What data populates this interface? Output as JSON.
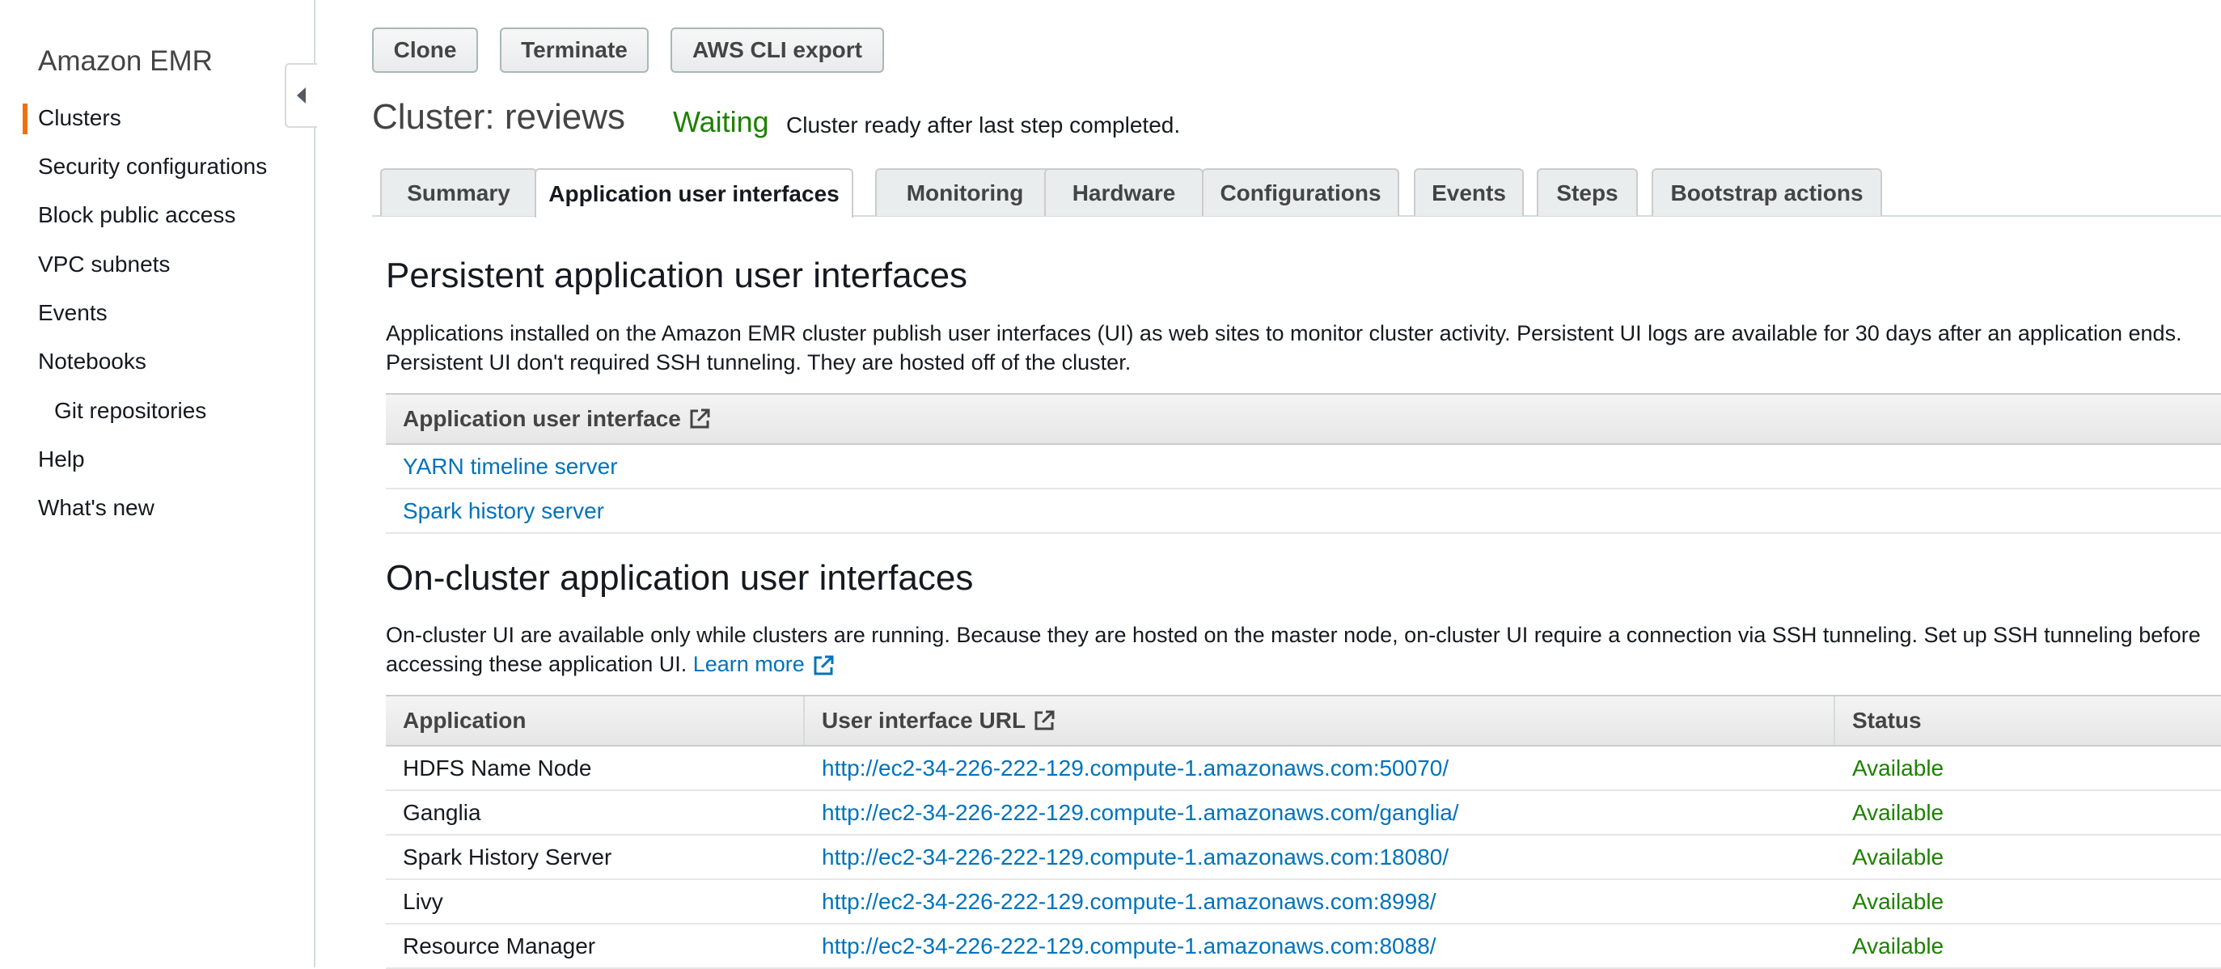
{
  "sidebar": {
    "title": "Amazon EMR",
    "items": [
      {
        "label": "Clusters",
        "active": true
      },
      {
        "label": "Security configurations"
      },
      {
        "label": "Block public access"
      },
      {
        "label": "VPC subnets"
      },
      {
        "label": "Events"
      },
      {
        "label": "Notebooks"
      },
      {
        "label": "Git repositories",
        "sub": true
      },
      {
        "label": "Help"
      },
      {
        "label": "What's new"
      }
    ],
    "accent_color": "#ec7211"
  },
  "toolbar": {
    "clone_label": "Clone",
    "terminate_label": "Terminate",
    "cli_export_label": "AWS CLI export"
  },
  "cluster": {
    "heading": "Cluster: reviews",
    "status": "Waiting",
    "status_description": "Cluster ready after last step completed.",
    "status_color": "#1d8102"
  },
  "tabs": [
    {
      "label": "Summary"
    },
    {
      "label": "Application user interfaces",
      "active": true
    },
    {
      "label": "Monitoring"
    },
    {
      "label": "Hardware"
    },
    {
      "label": "Configurations"
    },
    {
      "label": "Events"
    },
    {
      "label": "Steps"
    },
    {
      "label": "Bootstrap actions"
    }
  ],
  "persistent": {
    "title": "Persistent application user interfaces",
    "description": "Applications installed on the Amazon EMR cluster publish user interfaces (UI) as web sites to monitor cluster activity. Persistent UI logs are available for 30 days after an application ends. Persistent UI don't required SSH tunneling. They are hosted off of the cluster.",
    "column_header": "Application user interface",
    "column_icon": "external-link-icon",
    "rows": [
      {
        "label": "YARN timeline server"
      },
      {
        "label": "Spark history server"
      }
    ]
  },
  "on_cluster": {
    "title": "On-cluster application user interfaces",
    "description": "On-cluster UI are available only while clusters are running. Because they are hosted on the master node, on-cluster UI require a connection via SSH tunneling. Set up SSH tunneling before accessing these application UI.",
    "learn_more": "Learn more",
    "columns": {
      "application": "Application",
      "url": "User interface URL",
      "status": "Status"
    },
    "rows": [
      {
        "application": "HDFS Name Node",
        "url": "http://ec2-34-226-222-129.compute-1.amazonaws.com:50070/",
        "status": "Available"
      },
      {
        "application": "Ganglia",
        "url": "http://ec2-34-226-222-129.compute-1.amazonaws.com/ganglia/",
        "status": "Available"
      },
      {
        "application": "Spark History Server",
        "url": "http://ec2-34-226-222-129.compute-1.amazonaws.com:18080/",
        "status": "Available"
      },
      {
        "application": "Livy",
        "url": "http://ec2-34-226-222-129.compute-1.amazonaws.com:8998/",
        "status": "Available"
      },
      {
        "application": "Resource Manager",
        "url": "http://ec2-34-226-222-129.compute-1.amazonaws.com:8088/",
        "status": "Available"
      }
    ]
  },
  "colors": {
    "link": "#0073bb",
    "available": "#1d8102"
  }
}
